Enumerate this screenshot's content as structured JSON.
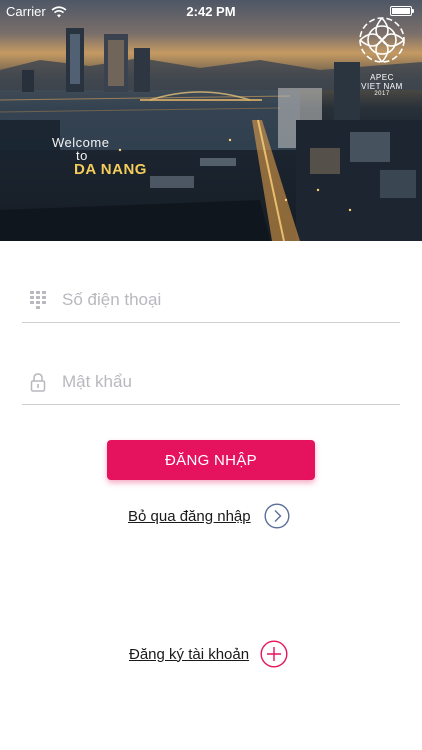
{
  "status_bar": {
    "carrier": "Carrier",
    "time": "2:42 PM"
  },
  "hero": {
    "welcome_line1": "Welcome",
    "welcome_line2": "to",
    "welcome_city": "DA NANG",
    "apec_line1": "APEC",
    "apec_line2": "VIET NAM",
    "apec_year": "2017"
  },
  "form": {
    "phone_placeholder": "Số điện thoại",
    "password_placeholder": "Mật khẩu",
    "phone_icon": "keypad-icon",
    "password_icon": "lock-icon"
  },
  "actions": {
    "login_label": "ĐĂNG NHẬP",
    "skip_label": "Bỏ qua đăng nhập",
    "register_label": "Đăng ký tài khoản"
  },
  "colors": {
    "accent": "#e5135d",
    "skip_icon": "#5b6f9a",
    "register_icon": "#e5135d"
  }
}
